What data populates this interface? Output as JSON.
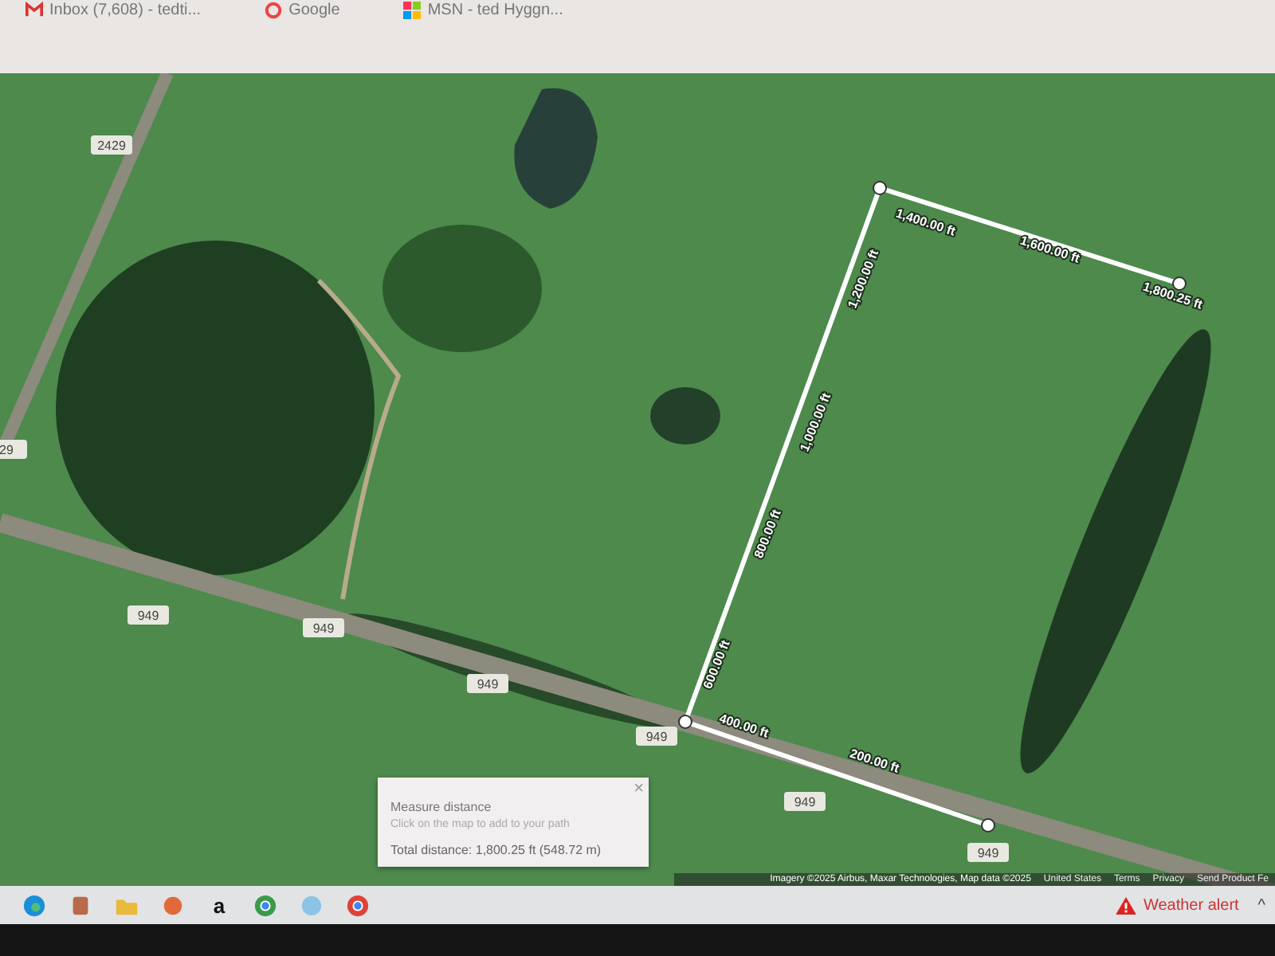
{
  "bookmarks": [
    {
      "kind": "mail",
      "label": "Inbox (7,608) - tedti..."
    },
    {
      "kind": "google",
      "label": "Google"
    },
    {
      "kind": "msn",
      "label": "MSN - ted Hyggn..."
    }
  ],
  "map": {
    "road_labels": [
      "2429",
      "29",
      "949",
      "949",
      "949",
      "949",
      "949",
      "949"
    ],
    "segment_labels": [
      "200.00 ft",
      "400.00 ft",
      "600.00 ft",
      "800.00 ft",
      "1,000.00 ft",
      "1,200.00 ft",
      "1,400.00 ft",
      "1,600.00 ft",
      "1,800.25 ft"
    ],
    "measure_panel": {
      "title": "Measure distance",
      "hint": "Click on the map to add to your path",
      "total": "Total distance: 1,800.25 ft (548.72 m)",
      "close": "×"
    },
    "attribution": "Imagery ©2025 Airbus, Maxar Technologies, Map data ©2025",
    "footer_links": [
      "United States",
      "Terms",
      "Privacy",
      "Send Product Fe"
    ]
  },
  "taskbar": {
    "apps": [
      {
        "kind": "edge"
      },
      {
        "kind": "app"
      },
      {
        "kind": "folder"
      },
      {
        "kind": "app2"
      },
      {
        "kind": "amazon",
        "label": "a"
      },
      {
        "kind": "chrome"
      },
      {
        "kind": "globe"
      },
      {
        "kind": "chrome2"
      }
    ],
    "weather_alert": "Weather alert",
    "tray_chevron": "^"
  }
}
